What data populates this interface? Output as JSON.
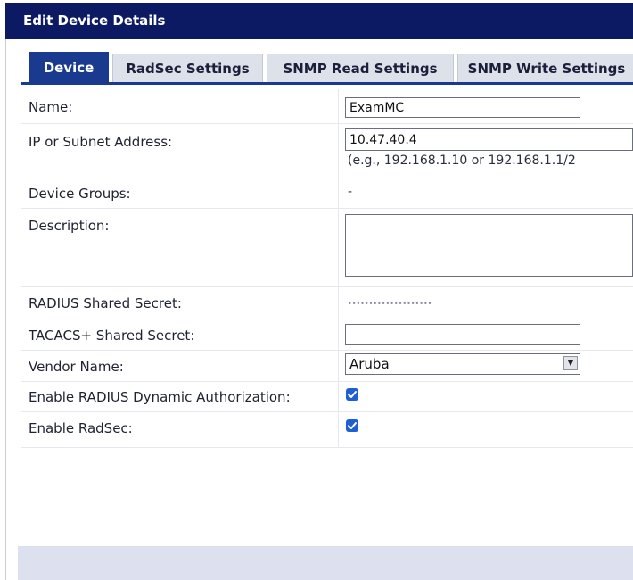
{
  "window": {
    "title": "Edit Device Details"
  },
  "tabs": [
    {
      "label": "Device",
      "active": true
    },
    {
      "label": "RadSec Settings",
      "active": false
    },
    {
      "label": "SNMP Read Settings",
      "active": false
    },
    {
      "label": "SNMP Write Settings",
      "active": false
    }
  ],
  "form": {
    "name": {
      "label": "Name:",
      "value": "ExamMC"
    },
    "ip": {
      "label": "IP or Subnet Address:",
      "value": "10.47.40.4",
      "hint": "(e.g., 192.168.1.10 or 192.168.1.1/2"
    },
    "device_groups": {
      "label": "Device Groups:",
      "value": "-"
    },
    "description": {
      "label": "Description:",
      "value": ""
    },
    "radius_secret": {
      "label": "RADIUS Shared Secret:",
      "value": "••••••••••••••••••••"
    },
    "tacacs_secret": {
      "label": "TACACS+ Shared Secret:",
      "value": ""
    },
    "vendor": {
      "label": "Vendor Name:",
      "value": "Aruba"
    },
    "radius_dynamic": {
      "label": "Enable RADIUS Dynamic Authorization:",
      "checked": true
    },
    "radsec": {
      "label": "Enable RadSec:",
      "checked": true
    }
  },
  "colors": {
    "title_bar": "#0c1a64",
    "active_tab": "#1a3a8f",
    "inactive_tab": "#dde1ea",
    "checkbox": "#1f5fd6",
    "footer": "#dde0ee"
  },
  "icons": {
    "select_arrow": "chevron-down-icon",
    "checkbox_mark": "checkmark-icon"
  }
}
